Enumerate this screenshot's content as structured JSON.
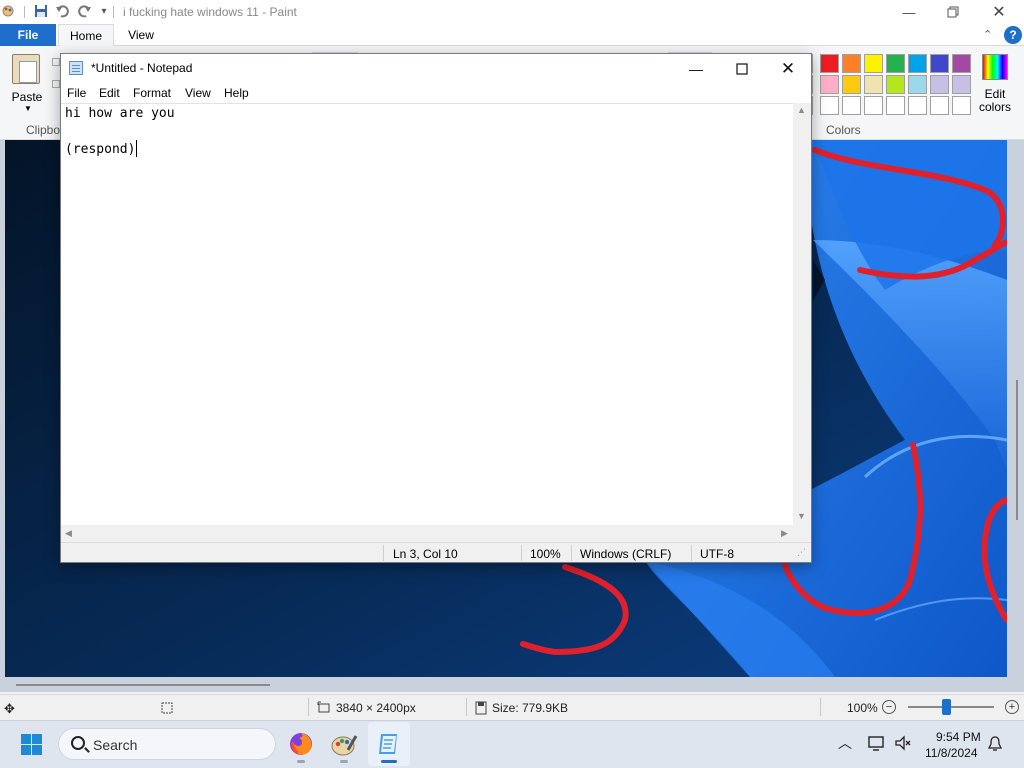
{
  "paint": {
    "window_title": "i fucking hate windows 11 - Paint",
    "tabs": [
      "File",
      "Home",
      "View"
    ],
    "help_symbol": "?",
    "ribbon": {
      "paste_label": "Paste",
      "clipboard_group_label": "Clipbo",
      "colors_group_label": "Colors",
      "edit_colors_label": "Edit colors",
      "palette_row1": [
        "#ed1c24",
        "#ff7f27",
        "#fff200",
        "#22b14c",
        "#00a2e8",
        "#3f48cc",
        "#a349a4"
      ],
      "palette_row2": [
        "#ffaec9",
        "#ffc90e",
        "#efe4b0",
        "#b5e61d",
        "#99d9ea",
        "#c8bfe7",
        "#c8bfe7"
      ],
      "palette_row3": [
        "#ffffff",
        "#ffffff",
        "#ffffff",
        "#ffffff",
        "#ffffff",
        "#ffffff",
        "#ffffff"
      ]
    },
    "status": {
      "dimensions": "3840 × 2400px",
      "size": "Size: 779.9KB",
      "zoom": "100%",
      "zoom_level": 0.45
    }
  },
  "notepad": {
    "title": "*Untitled - Notepad",
    "menu": [
      "File",
      "Edit",
      "Format",
      "View",
      "Help"
    ],
    "lines": [
      "hi how are you",
      "",
      "(respond)"
    ],
    "status": {
      "position": "Ln 3, Col 10",
      "zoom": "100%",
      "line_ending": "Windows (CRLF)",
      "encoding": "UTF-8"
    }
  },
  "taskbar": {
    "search_label": "Search",
    "time": "9:54 PM",
    "date": "11/8/2024",
    "pinned_apps": [
      "firefox-icon",
      "paint-icon",
      "notepad-icon"
    ]
  },
  "colors": {
    "accent": "#1e6fcc",
    "wallpaper_dark": "#061a33",
    "wallpaper_blue": "#1d6fe0",
    "scribble_red": "#e0202a"
  }
}
